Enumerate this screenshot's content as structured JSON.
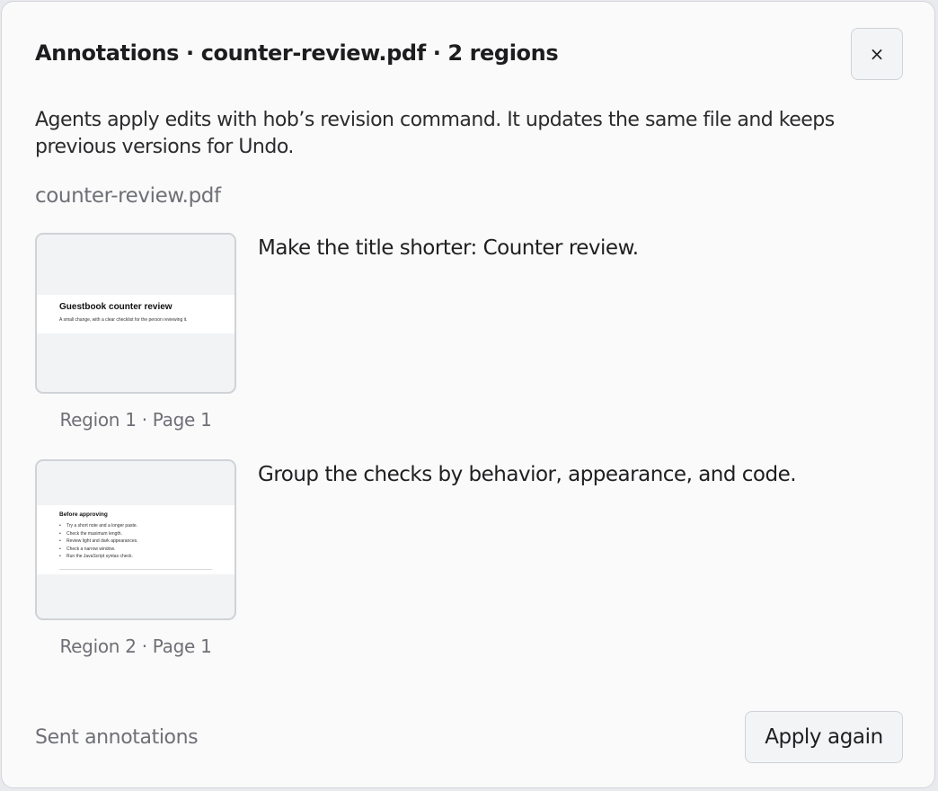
{
  "dialog": {
    "title": "Annotations · counter-review.pdf · 2 regions",
    "close_label": "×",
    "description": "Agents apply edits with hob’s revision command. It updates the same file and keeps previous versions for Undo.",
    "filename": "counter-review.pdf"
  },
  "regions": [
    {
      "caption": "Region 1 · Page 1",
      "comment": "Make the title shorter: Counter review.",
      "thumbnail": {
        "heading": "Guestbook counter review",
        "text": "A small change, with a clear checklist for the person reviewing it."
      }
    },
    {
      "caption": "Region 2 · Page 1",
      "comment": "Group the checks by behavior, appearance, and code.",
      "thumbnail": {
        "heading": "Before approving",
        "items": [
          "Try a short note and a longer paste.",
          "Check the maximum length.",
          "Review light and dark appearances.",
          "Check a narrow window.",
          "Run the JavaScript syntax check."
        ]
      }
    }
  ],
  "footer": {
    "status": "Sent annotations",
    "apply_label": "Apply again"
  }
}
